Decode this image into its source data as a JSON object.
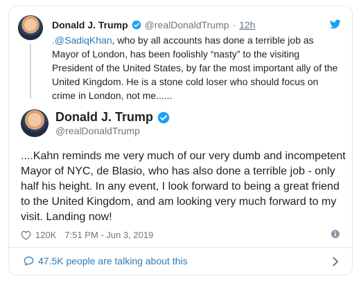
{
  "quoted": {
    "name": "Donald J. Trump",
    "handle": "@realDonaldTrump",
    "separator": "·",
    "time": "12h",
    "mention": ".@SadiqKhan",
    "text": ", who by all accounts has done a terrible job as Mayor of London, has been foolishly “nasty” to the visiting President of the United States, by far the most important ally of the United Kingdom. He is a stone cold loser who should focus on crime in London, not me......"
  },
  "main": {
    "name": "Donald J. Trump",
    "handle": "@realDonaldTrump",
    "text": "....Kahn reminds me very much of our very dumb and incompetent Mayor of NYC, de Blasio, who has also done a terrible job - only half his height. In any event, I look forward to being a great friend to the United Kingdom, and am looking very much forward to my visit. Landing now!",
    "likes": "120K",
    "timestamp": "7:51 PM - Jun 3, 2019"
  },
  "footer": {
    "talking_text": "47.5K people are talking about this"
  },
  "colors": {
    "link": "#2b7bb9",
    "verified": "#1da1f2",
    "muted": "#697882"
  },
  "icons": [
    "verified-badge-icon",
    "twitter-bird-icon",
    "heart-icon",
    "info-icon",
    "chat-bubble-icon",
    "chevron-right-icon"
  ]
}
